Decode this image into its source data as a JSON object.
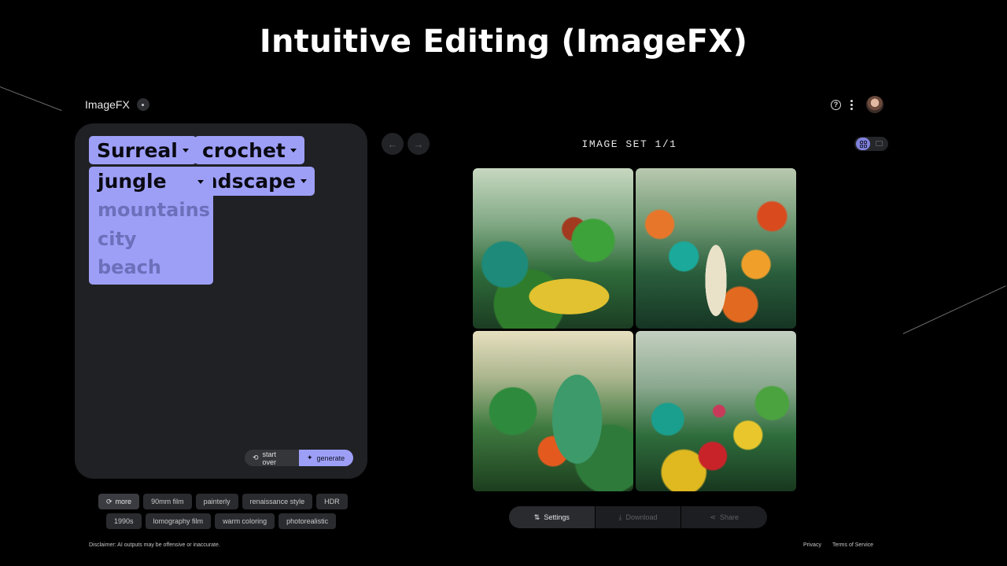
{
  "slide": {
    "title": "Intuitive Editing (ImageFX)"
  },
  "app": {
    "name": "ImageFX"
  },
  "prompt": {
    "chips": [
      {
        "label": "Surreal"
      },
      {
        "label": "crochet"
      },
      {
        "label": "landscape",
        "visible_label": "ndscape"
      }
    ],
    "dropdown": {
      "selected": "jungle",
      "options": [
        "mountains",
        "city",
        "beach"
      ]
    },
    "actions": {
      "start_over": "start over",
      "generate": "generate"
    }
  },
  "suggestions": {
    "more": "more",
    "row1": [
      "90mm film",
      "painterly",
      "renaissance style",
      "HDR"
    ],
    "row2": [
      "1990s",
      "lomography film",
      "warm coloring",
      "photorealistic"
    ]
  },
  "results": {
    "label": "IMAGE SET 1/1",
    "images": [
      {
        "alt": "crochet jungle with yellow path"
      },
      {
        "alt": "crochet mushroom forest"
      },
      {
        "alt": "crochet green mound"
      },
      {
        "alt": "crochet flowers and mushrooms"
      }
    ],
    "bottom_bar": {
      "settings": "Settings",
      "download": "Download",
      "share": "Share"
    }
  },
  "footer": {
    "disclaimer": "Disclaimer: AI outputs may be offensive or inaccurate.",
    "privacy": "Privacy",
    "terms": "Terms of Service"
  }
}
